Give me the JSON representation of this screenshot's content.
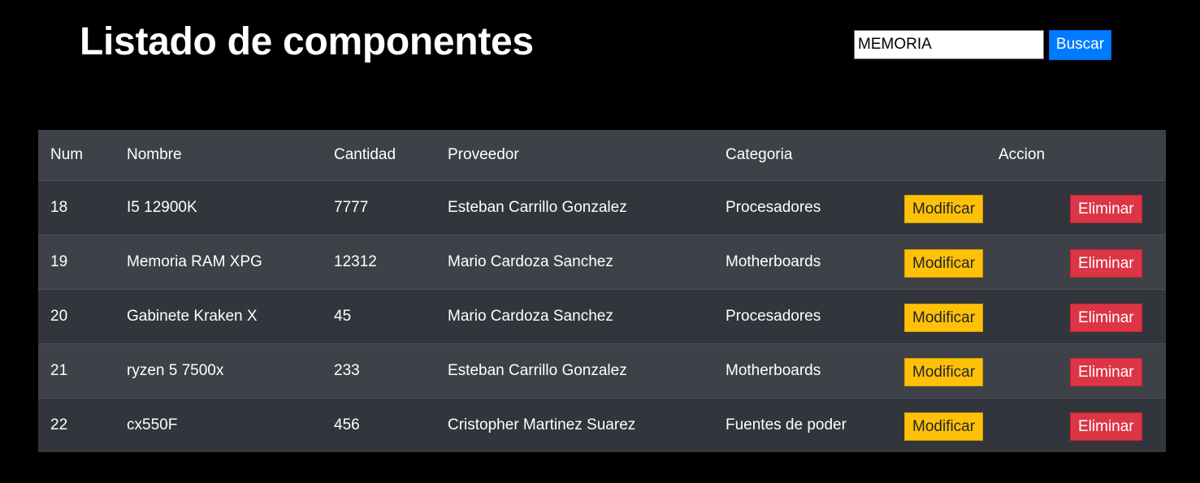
{
  "header": {
    "title": "Listado de componentes"
  },
  "search": {
    "value": "MEMORIA",
    "button_label": "Buscar",
    "button_color": "#007bff"
  },
  "table": {
    "columns": {
      "num": "Num",
      "nombre": "Nombre",
      "cantidad": "Cantidad",
      "proveedor": "Proveedor",
      "categoria": "Categoria",
      "accion": "Accion"
    },
    "modify_label": "Modificar",
    "delete_label": "Eliminar",
    "modify_color": "#ffc107",
    "delete_color": "#dc3545",
    "rows": [
      {
        "num": "18",
        "nombre": "I5 12900K",
        "cantidad": "7777",
        "proveedor": "Esteban Carrillo Gonzalez",
        "categoria": "Procesadores"
      },
      {
        "num": "19",
        "nombre": "Memoria RAM XPG",
        "cantidad": "12312",
        "proveedor": "Mario Cardoza Sanchez",
        "categoria": "Motherboards"
      },
      {
        "num": "20",
        "nombre": "Gabinete Kraken X",
        "cantidad": "45",
        "proveedor": "Mario Cardoza Sanchez",
        "categoria": "Procesadores"
      },
      {
        "num": "21",
        "nombre": "ryzen 5 7500x",
        "cantidad": "233",
        "proveedor": "Esteban Carrillo Gonzalez",
        "categoria": "Motherboards"
      },
      {
        "num": "22",
        "nombre": "cx550F",
        "cantidad": "456",
        "proveedor": "Cristopher Martinez Suarez",
        "categoria": "Fuentes de poder"
      }
    ]
  }
}
